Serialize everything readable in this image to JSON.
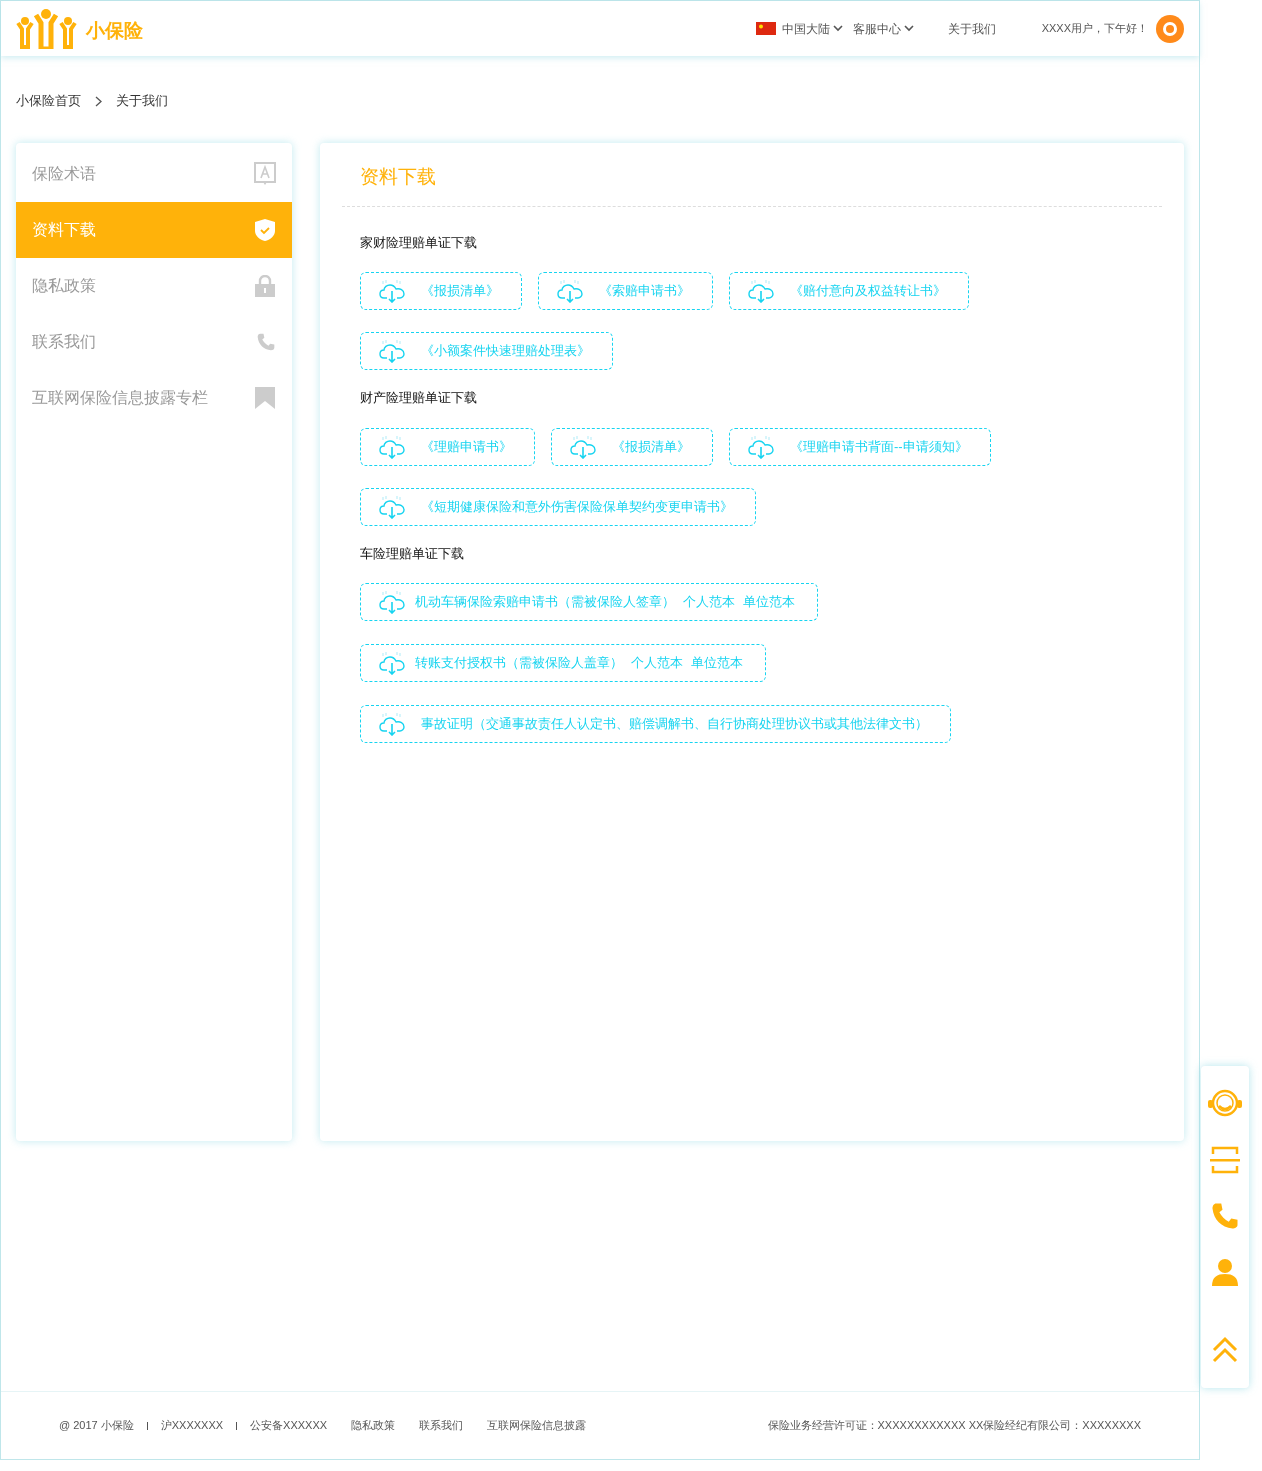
{
  "header": {
    "brand": "小保险",
    "region": "中国大陆",
    "service": "客服中心",
    "about": "关于我们",
    "greeting": "XXXX用户，下午好！"
  },
  "breadcrumb": [
    "小保险首页",
    "关于我们"
  ],
  "sidebar": {
    "items": [
      {
        "label": "保险术语",
        "kind": "term",
        "selected": false
      },
      {
        "label": "资料下载",
        "kind": "shield",
        "selected": true
      },
      {
        "label": "隐私政策",
        "kind": "lock",
        "selected": false
      },
      {
        "label": "联系我们",
        "kind": "phone",
        "selected": false
      },
      {
        "label": "互联网保险信息披露专栏",
        "kind": "bookmark",
        "selected": false
      }
    ]
  },
  "content": {
    "title": "资料下载",
    "sections": [
      {
        "heading": "家财险理赔单证下载",
        "files": [
          {
            "title": "《报损清单》"
          },
          {
            "title": "《索赔申请书》"
          },
          {
            "title": "《赔付意向及权益转让书》"
          },
          {
            "title": "《小额案件快速理赔处理表》"
          }
        ]
      },
      {
        "heading": "财产险理赔单证下载",
        "files": [
          {
            "title": "《理赔申请书》"
          },
          {
            "title": "《报损清单》"
          },
          {
            "title": "《理赔申请书背面--申请须知》"
          },
          {
            "title": "《短期健康保险和意外伤害保险保单契约变更申请书》"
          }
        ]
      },
      {
        "heading": "车险理赔单证下载",
        "files": [
          {
            "title": "机动车辆保险索赔申请书（需被保险人签章）",
            "links": [
              "个人范本",
              "单位范本"
            ]
          },
          {
            "title": "转账支付授权书（需被保险人盖章）",
            "links": [
              "个人范本",
              "单位范本"
            ]
          },
          {
            "title": "事故证明（交通事故责任人认定书、赔偿调解书、自行协商处理协议书或其他法律文书）"
          }
        ]
      }
    ]
  },
  "float_bar": [
    {
      "kind": "headset"
    },
    {
      "kind": "scan"
    },
    {
      "kind": "phone"
    },
    {
      "kind": "user"
    },
    {
      "kind": "top"
    }
  ],
  "footer": {
    "left": [
      "@ 2017  小保险",
      "沪XXXXXXX",
      "公安备XXXXXX",
      "隐私政策",
      "联系我们",
      "互联网保险信息披露"
    ],
    "right": "保险业务经营许可证：XXXXXXXXXXXX  XX保险经纪有限公司：XXXXXXXX"
  }
}
